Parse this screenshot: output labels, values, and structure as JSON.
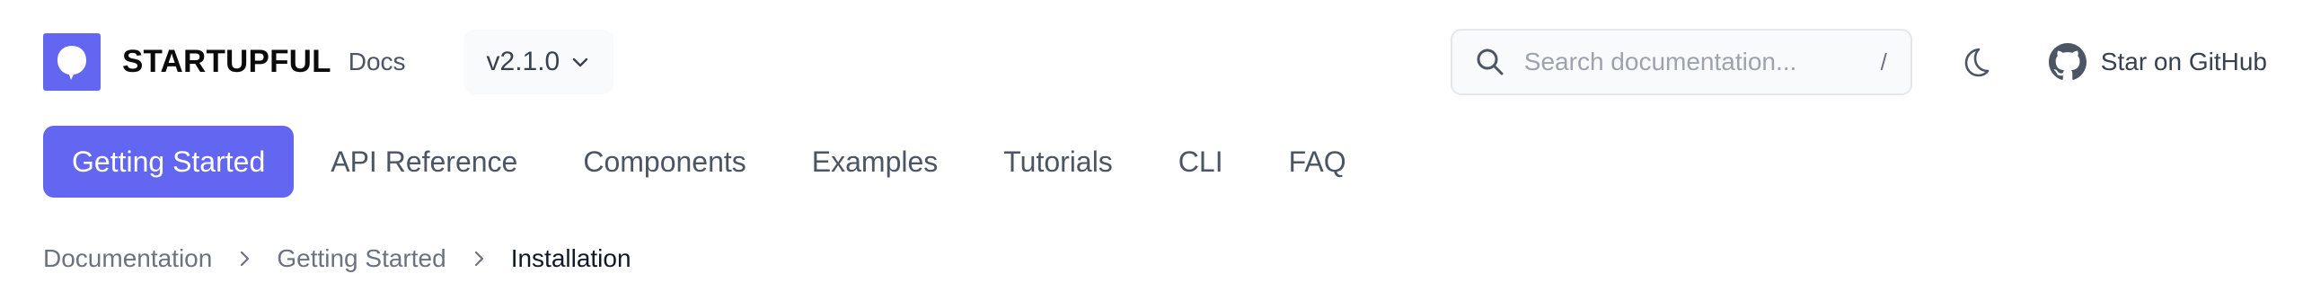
{
  "brand": {
    "name": "STARTUPFUL",
    "suffix": "Docs",
    "logo_icon": "speech-bubble-logo",
    "accent": "#6366f1"
  },
  "version": {
    "selected": "v2.1.0",
    "icon": "chevron-down-icon"
  },
  "search": {
    "placeholder": "Search documentation...",
    "value": "",
    "shortcut": "/",
    "icon": "search-icon"
  },
  "theme_toggle": {
    "icon": "moon-icon"
  },
  "github": {
    "label": "Star on GitHub",
    "icon": "github-icon"
  },
  "tabs": [
    {
      "label": "Getting Started",
      "active": true
    },
    {
      "label": "API Reference",
      "active": false
    },
    {
      "label": "Components",
      "active": false
    },
    {
      "label": "Examples",
      "active": false
    },
    {
      "label": "Tutorials",
      "active": false
    },
    {
      "label": "CLI",
      "active": false
    },
    {
      "label": "FAQ",
      "active": false
    }
  ],
  "breadcrumb": {
    "items": [
      "Documentation",
      "Getting Started",
      "Installation"
    ],
    "separator_icon": "chevron-right-icon"
  },
  "colors": {
    "accent": "#6366f1",
    "text_muted": "#4b5563",
    "border": "#e5e7eb"
  }
}
